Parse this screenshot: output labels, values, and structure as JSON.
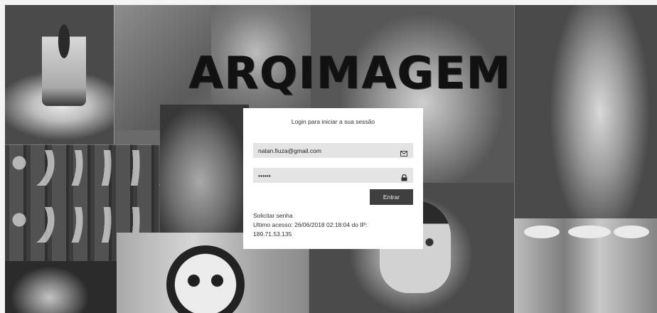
{
  "brand": {
    "logo_text": "ARQIMAGEM"
  },
  "login": {
    "title": "Login para iniciar a sua sessão",
    "email_value": "natan.fiuza@gmail.com",
    "password_value": "••••••",
    "submit_label": "Entrar",
    "request_password_link": "Solicitar senha",
    "last_access_line1": "Ultimo acesso: 26/06/2018 02:18:04 do IP:",
    "last_access_line2": "189.71.53.135"
  },
  "icons": {
    "email": "envelope-icon",
    "password": "lock-icon"
  },
  "colors": {
    "button_bg": "#3f3f3f",
    "field_bg": "#e4e4e4",
    "card_bg": "#ffffff",
    "logo": "#111111"
  }
}
